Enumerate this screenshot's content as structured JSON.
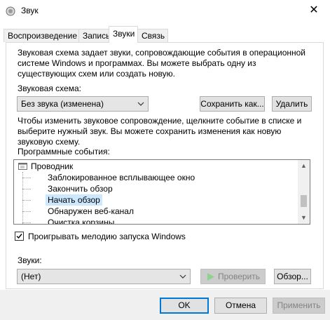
{
  "window": {
    "title": "Звук",
    "close_glyph": "✕"
  },
  "tabs": [
    {
      "label": "Воспроизведение"
    },
    {
      "label": "Запись"
    },
    {
      "label": "Звуки"
    },
    {
      "label": "Связь"
    }
  ],
  "sounds_tab": {
    "description": "Звуковая схема задает звуки, сопровождающие события в операционной системе Windows и программах. Вы можете выбрать одну из существующих схем или создать новую.",
    "scheme_label": "Звуковая схема:",
    "scheme_value": "Без звука (изменена)",
    "save_as_label": "Сохранить как...",
    "delete_label": "Удалить",
    "instructions": "Чтобы изменить звуковое сопровождение, щелкните событие в списке и выберите нужный звук. Вы можете сохранить изменения как новую звуковую схему.",
    "events_label": "Программные события:",
    "events": {
      "group": "Проводник",
      "items": [
        "Заблокированное всплывающее окно",
        "Закончить обзор",
        "Начать обзор",
        "Обнаружен веб-канал",
        "Очистка корзины"
      ],
      "selected_index": 2
    },
    "startup_checkbox_label": "Проигрывать мелодию запуска Windows",
    "startup_checked": true,
    "sounds_label": "Звуки:",
    "sound_value": "(Нет)",
    "test_label": "Проверить",
    "browse_label": "Обзор..."
  },
  "footer": {
    "ok": "OK",
    "cancel": "Отмена",
    "apply": "Применить"
  },
  "colors": {
    "accent": "#0078d7",
    "selection": "#cce8ff",
    "play_disabled": "#8fd18f"
  }
}
